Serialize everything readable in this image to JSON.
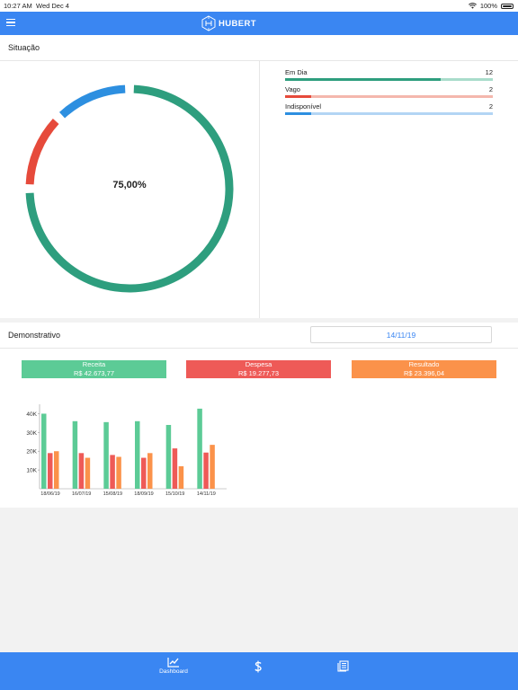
{
  "status_bar": {
    "time": "10:27 AM",
    "date": "Wed Dec 4",
    "battery": "100%"
  },
  "app": {
    "title": "HUBERT",
    "accent": "#3a86f2"
  },
  "situacao": {
    "title": "Situação",
    "percent_label": "75,00%",
    "donut": [
      {
        "name": "Em Dia",
        "value": 12,
        "color": "#2e9e7e"
      },
      {
        "name": "Vago",
        "value": 2,
        "color": "#e64a3b"
      },
      {
        "name": "Indisponível",
        "value": 2,
        "color": "#2d8fe0"
      }
    ],
    "items": [
      {
        "label": "Em Dia",
        "value": "12",
        "fraction": 0.75,
        "color": "#2e9e7e",
        "track": "#a9dccb"
      },
      {
        "label": "Vago",
        "value": "2",
        "fraction": 0.125,
        "color": "#e64a3b",
        "track": "#f4b7ad"
      },
      {
        "label": "Indisponível",
        "value": "2",
        "fraction": 0.125,
        "color": "#2d8fe0",
        "track": "#b3d5f4"
      }
    ]
  },
  "demonstrativo": {
    "title": "Demonstrativo",
    "date": "14/11/19",
    "summary": [
      {
        "label": "Receita",
        "value": "R$ 42.673,77",
        "color": "#5ccb96"
      },
      {
        "label": "Despesa",
        "value": "R$ 19.277,73",
        "color": "#ee5a57"
      },
      {
        "label": "Resultado",
        "value": "R$ 23.396,04",
        "color": "#fb924a"
      }
    ]
  },
  "chart_data": {
    "type": "bar",
    "categories": [
      "18/06/19",
      "16/07/19",
      "15/08/19",
      "18/09/19",
      "15/10/19",
      "14/11/19"
    ],
    "series": [
      {
        "name": "Receita",
        "color": "#5ccb96",
        "values": [
          40000,
          36000,
          35500,
          36000,
          34000,
          42673.77
        ]
      },
      {
        "name": "Despesa",
        "color": "#ee5a57",
        "values": [
          19000,
          19000,
          18000,
          16500,
          21500,
          19277.73
        ]
      },
      {
        "name": "Resultado",
        "color": "#fb924a",
        "values": [
          20000,
          16500,
          17000,
          19000,
          12000,
          23396.04
        ]
      }
    ],
    "yticks": [
      "10K",
      "20K",
      "30K",
      "40K"
    ],
    "ylim": [
      0,
      45000
    ],
    "grid": false
  },
  "tabs": [
    {
      "label": "Dashboard",
      "icon": "chart-line-icon"
    },
    {
      "label": "",
      "icon": "dollar-icon"
    },
    {
      "label": "",
      "icon": "newspaper-icon"
    }
  ]
}
